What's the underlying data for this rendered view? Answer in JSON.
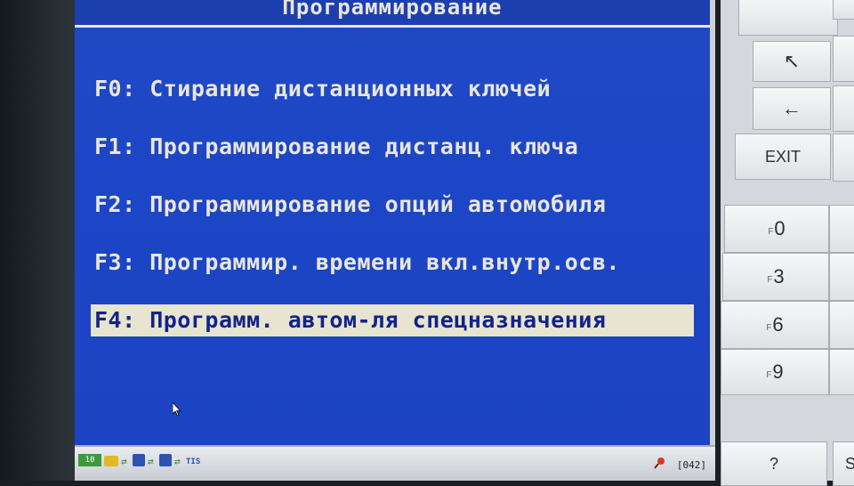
{
  "screen": {
    "title": "Программирование",
    "menu": [
      {
        "label": "F0: Стирание дистанционных ключей",
        "selected": false
      },
      {
        "label": "F1: Программирование дистанц. ключа",
        "selected": false
      },
      {
        "label": "F2: Программирование опций автомобиля",
        "selected": false
      },
      {
        "label": "F3: Программир. времени вкл.внутр.осв.",
        "selected": false
      },
      {
        "label": "F4: Программ. автом-ля спецназначения",
        "selected": true
      }
    ]
  },
  "status_bar": {
    "signal_label": "10",
    "tis_label": "TIS",
    "code": "[042]"
  },
  "keypad": {
    "exit_label": "EXIT",
    "f_prefix": "F",
    "f0": "0",
    "f3": "3",
    "f6": "6",
    "f9": "9",
    "help_label": "?",
    "s_label": "S",
    "arrow_up_left": "↖",
    "arrow_left": "←"
  },
  "colors": {
    "screen_blue": "#1d46c6",
    "menu_text": "#e9e6d8",
    "selected_bg": "#e7e4d0",
    "selected_text": "#13238a"
  }
}
